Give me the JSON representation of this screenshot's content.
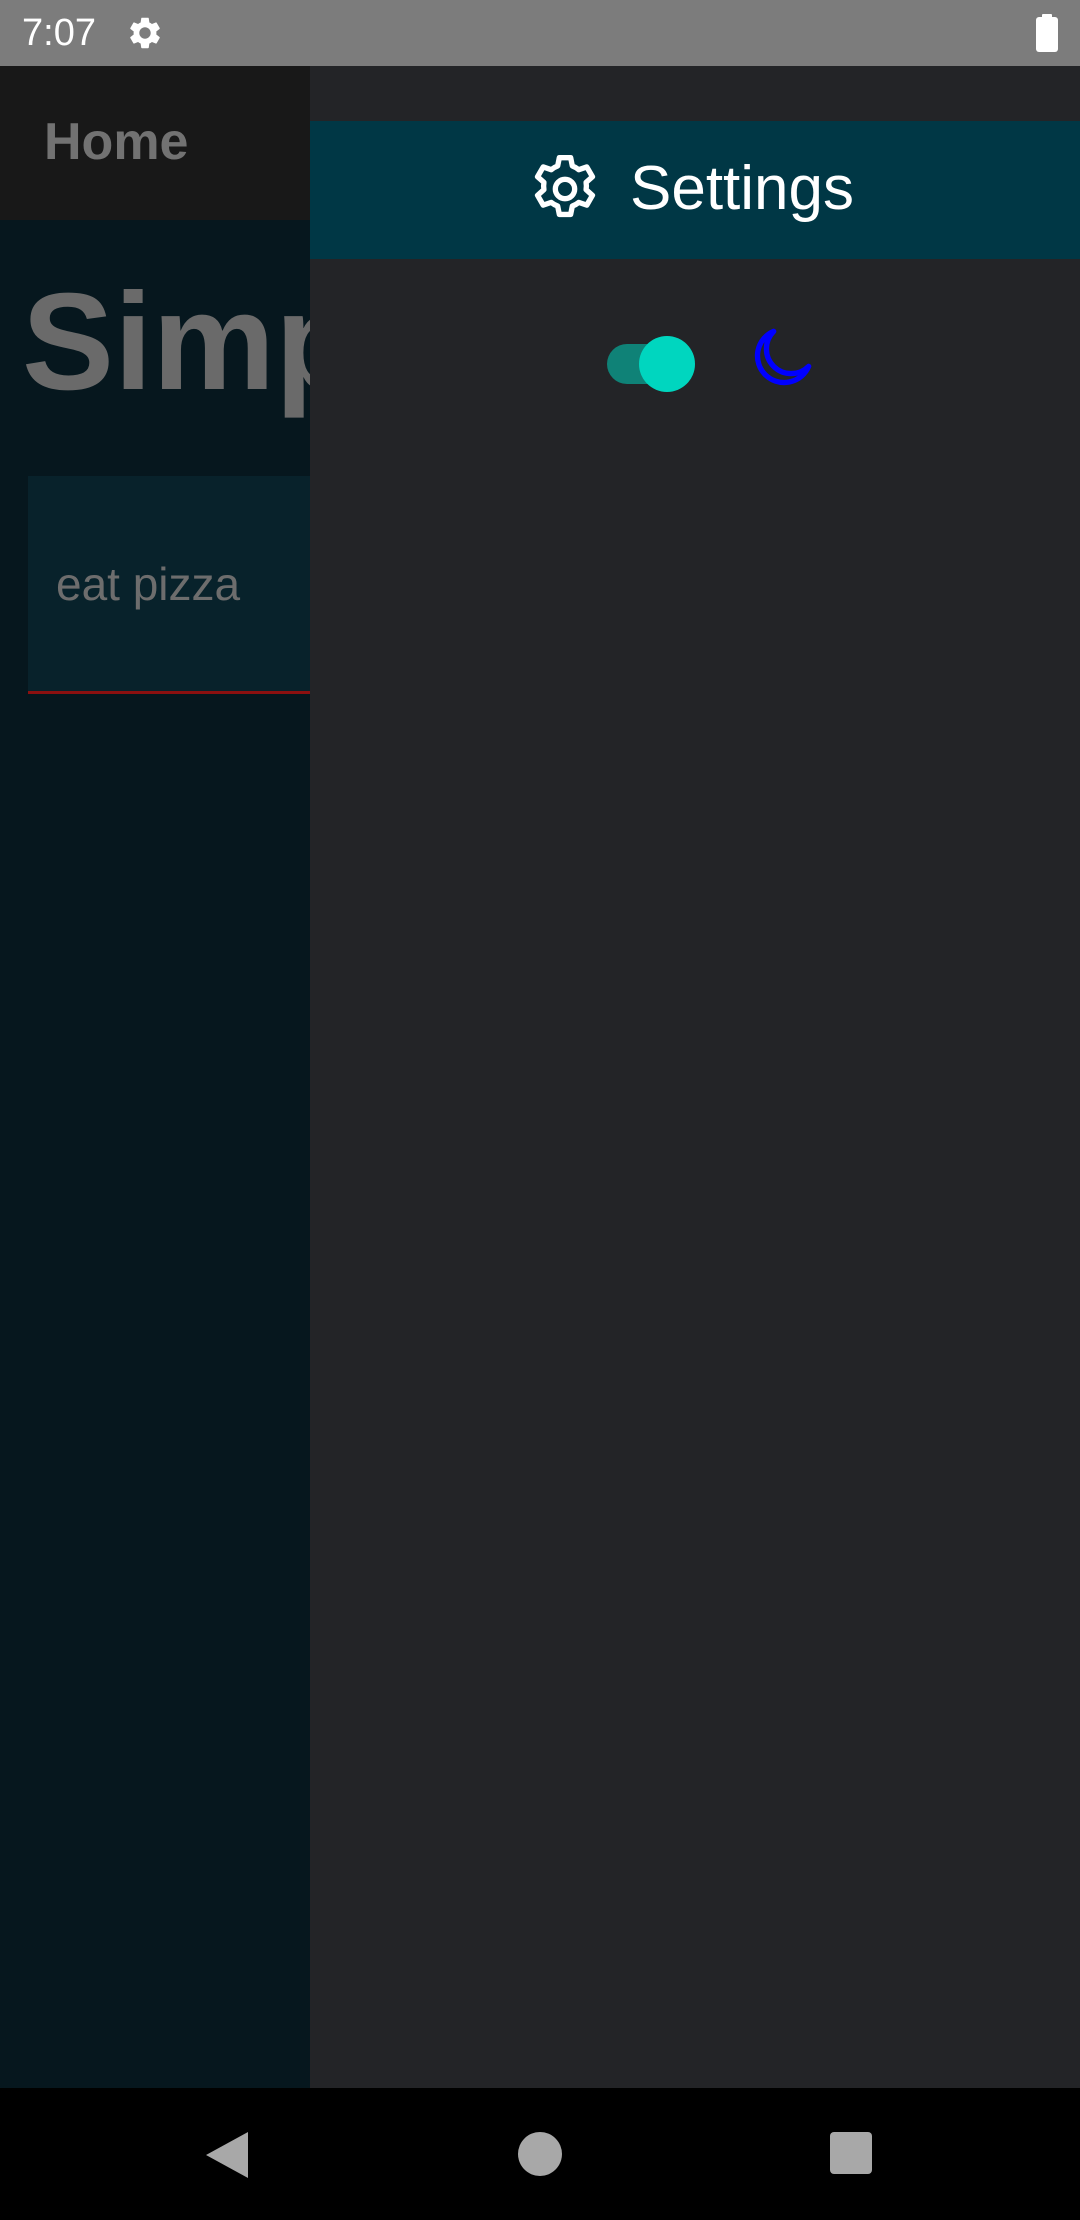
{
  "status_bar": {
    "time": "7:07",
    "icons": [
      "gear-icon",
      "battery-icon"
    ]
  },
  "app": {
    "header_title": "Home",
    "page_title": "Simp",
    "todo_items": [
      {
        "text": "eat pizza"
      }
    ]
  },
  "drawer": {
    "header": {
      "icon": "gear-icon",
      "title": "Settings"
    },
    "dark_mode_toggle": {
      "state": "on",
      "icon": "moon-icon"
    }
  },
  "colors": {
    "drawer_header_bg": "#003745",
    "drawer_bg": "#232427",
    "toggle_thumb": "#00d6bf",
    "toggle_track": "#0f8277",
    "moon_icon": "#0000ff",
    "todo_underline": "#8b1010"
  },
  "nav_bar": {
    "buttons": [
      "back-icon",
      "home-icon",
      "recents-icon"
    ]
  }
}
